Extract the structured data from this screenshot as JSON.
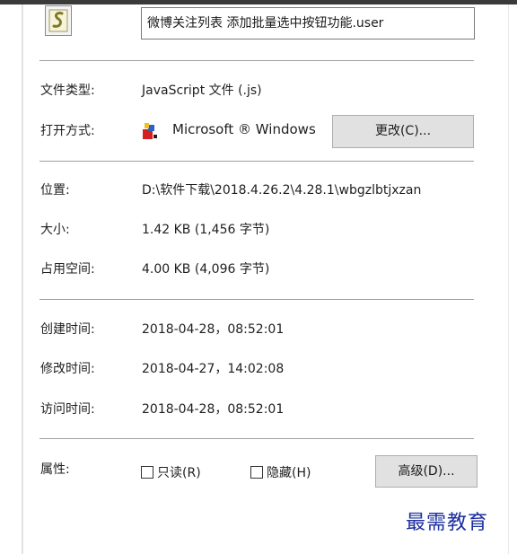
{
  "file": {
    "name": "微博关注列表 添加批量选中按钮功能.user"
  },
  "fields": {
    "type_label": "文件类型:",
    "type_value": "JavaScript 文件 (.js)",
    "opens_label": "打开方式:",
    "opens_value": "Microsoft ® Windows",
    "change_button": "更改(C)...",
    "location_label": "位置:",
    "location_value": "D:\\软件下载\\2018.4.26.2\\4.28.1\\wbgzlbtjxzan",
    "size_label": "大小:",
    "size_value": "1.42 KB (1,456 字节)",
    "disk_size_label": "占用空间:",
    "disk_size_value": "4.00 KB (4,096 字节)",
    "created_label": "创建时间:",
    "created_value": "2018-04-28，08:52:01",
    "modified_label": "修改时间:",
    "modified_value": "2018-04-27，14:02:08",
    "accessed_label": "访问时间:",
    "accessed_value": "2018-04-28，08:52:01",
    "attributes_label": "属性:",
    "readonly_label": "只读(R)",
    "hidden_label": "隐藏(H)",
    "advanced_button": "高级(D)..."
  },
  "attributes": {
    "readonly_checked": false,
    "hidden_checked": false
  },
  "watermark": {
    "text": "最需教育"
  },
  "icons": {
    "file_icon": "script-file-icon",
    "app_icon": "windows-script-host-icon"
  },
  "colors": {
    "separator": "#a0a0a0",
    "button_bg": "#e1e1e1",
    "watermark": "#1c2f9e"
  }
}
